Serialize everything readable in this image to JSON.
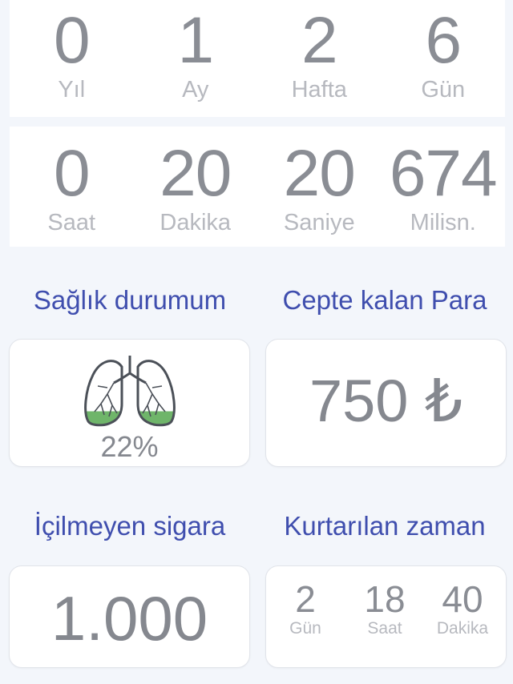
{
  "timer_row1": [
    {
      "value": "0",
      "unit": "Yıl"
    },
    {
      "value": "1",
      "unit": "Ay"
    },
    {
      "value": "2",
      "unit": "Hafta"
    },
    {
      "value": "6",
      "unit": "Gün"
    }
  ],
  "timer_row2": [
    {
      "value": "0",
      "unit": "Saat"
    },
    {
      "value": "20",
      "unit": "Dakika"
    },
    {
      "value": "20",
      "unit": "Saniye"
    },
    {
      "value": "674",
      "unit": "Milisn."
    }
  ],
  "health": {
    "title": "Sağlık durumum",
    "percent_label": "22%",
    "percent": 22,
    "icon": "lungs-icon"
  },
  "money": {
    "title": "Cepte kalan Para",
    "value": "750 ₺"
  },
  "cigarettes": {
    "title": "İçilmeyen sigara",
    "value": "1.000"
  },
  "saved_time": {
    "title": "Kurtarılan zaman",
    "items": [
      {
        "value": "2",
        "unit": "Gün"
      },
      {
        "value": "18",
        "unit": "Saat"
      },
      {
        "value": "40",
        "unit": "Dakika"
      }
    ]
  },
  "colors": {
    "accent": "#3f4eae",
    "lung_fill": "#6fb56a",
    "number": "#8a8d94"
  }
}
